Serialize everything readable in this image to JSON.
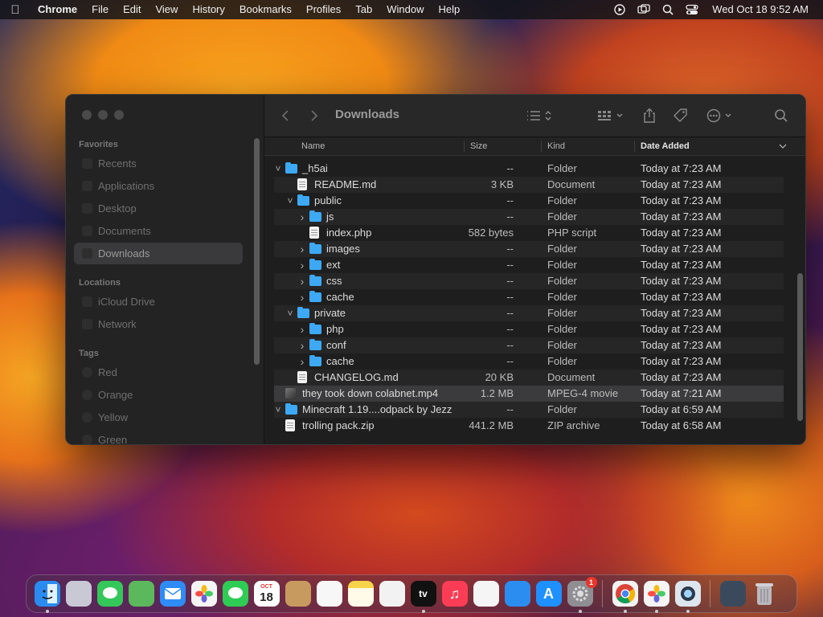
{
  "menubar": {
    "app": "Chrome",
    "items": [
      "File",
      "Edit",
      "View",
      "History",
      "Bookmarks",
      "Profiles",
      "Tab",
      "Window",
      "Help"
    ],
    "clock": "Wed Oct 18  9:52 AM"
  },
  "finder": {
    "title": "Downloads",
    "sidebar": {
      "favorites_label": "Favorites",
      "favorites": [
        "Recents",
        "Applications",
        "Desktop",
        "Documents",
        "Downloads"
      ],
      "locations_label": "Locations",
      "locations": [
        "iCloud Drive",
        "Network"
      ],
      "tags_label": "Tags",
      "tags": [
        "Red",
        "Orange",
        "Yellow",
        "Green"
      ]
    },
    "columns": {
      "name": "Name",
      "size": "Size",
      "kind": "Kind",
      "date": "Date Added"
    },
    "rows": [
      {
        "name": "_h5ai",
        "size": "--",
        "kind": "Folder",
        "date": "Today at 7:23 AM",
        "level": 0,
        "icon": "folder",
        "chevron": "down"
      },
      {
        "name": "README.md",
        "size": "3 KB",
        "kind": "Document",
        "date": "Today at 7:23 AM",
        "level": 1,
        "icon": "doc",
        "chevron": ""
      },
      {
        "name": "public",
        "size": "--",
        "kind": "Folder",
        "date": "Today at 7:23 AM",
        "level": 1,
        "icon": "folder",
        "chevron": "down"
      },
      {
        "name": "js",
        "size": "--",
        "kind": "Folder",
        "date": "Today at 7:23 AM",
        "level": 2,
        "icon": "folder",
        "chevron": "right"
      },
      {
        "name": "index.php",
        "size": "582 bytes",
        "kind": "PHP script",
        "date": "Today at 7:23 AM",
        "level": 2,
        "icon": "doc",
        "chevron": ""
      },
      {
        "name": "images",
        "size": "--",
        "kind": "Folder",
        "date": "Today at 7:23 AM",
        "level": 2,
        "icon": "folder",
        "chevron": "right"
      },
      {
        "name": "ext",
        "size": "--",
        "kind": "Folder",
        "date": "Today at 7:23 AM",
        "level": 2,
        "icon": "folder",
        "chevron": "right"
      },
      {
        "name": "css",
        "size": "--",
        "kind": "Folder",
        "date": "Today at 7:23 AM",
        "level": 2,
        "icon": "folder",
        "chevron": "right"
      },
      {
        "name": "cache",
        "size": "--",
        "kind": "Folder",
        "date": "Today at 7:23 AM",
        "level": 2,
        "icon": "folder",
        "chevron": "right"
      },
      {
        "name": "private",
        "size": "--",
        "kind": "Folder",
        "date": "Today at 7:23 AM",
        "level": 1,
        "icon": "folder",
        "chevron": "down"
      },
      {
        "name": "php",
        "size": "--",
        "kind": "Folder",
        "date": "Today at 7:23 AM",
        "level": 2,
        "icon": "folder",
        "chevron": "right"
      },
      {
        "name": "conf",
        "size": "--",
        "kind": "Folder",
        "date": "Today at 7:23 AM",
        "level": 2,
        "icon": "folder",
        "chevron": "right"
      },
      {
        "name": "cache",
        "size": "--",
        "kind": "Folder",
        "date": "Today at 7:23 AM",
        "level": 2,
        "icon": "folder",
        "chevron": "right"
      },
      {
        "name": "CHANGELOG.md",
        "size": "20 KB",
        "kind": "Document",
        "date": "Today at 7:23 AM",
        "level": 1,
        "icon": "doc",
        "chevron": ""
      },
      {
        "name": "they took down colabnet.mp4",
        "size": "1.2 MB",
        "kind": "MPEG-4 movie",
        "date": "Today at 7:21 AM",
        "level": 0,
        "icon": "movie",
        "chevron": "",
        "selected": true
      },
      {
        "name": "Minecraft 1.19....odpack by Jezz",
        "size": "--",
        "kind": "Folder",
        "date": "Today at 6:59 AM",
        "level": 0,
        "icon": "folder",
        "chevron": "down"
      },
      {
        "name": "trolling pack.zip",
        "size": "441.2 MB",
        "kind": "ZIP archive",
        "date": "Today at 6:58 AM",
        "level": 0,
        "icon": "doc",
        "chevron": ""
      }
    ]
  },
  "dock": {
    "calendar_month": "OCT",
    "calendar_day": "18",
    "settings_badge": "1",
    "tv_label": "tv",
    "icons": [
      {
        "name": "finder-icon",
        "color": "#2a8cf0",
        "running": true
      },
      {
        "name": "launchpad-icon",
        "color": "#c9c9d6",
        "running": false
      },
      {
        "name": "messages-icon",
        "color": "#34c759",
        "running": false
      },
      {
        "name": "maps-icon",
        "color": "#5cb85c",
        "running": false
      },
      {
        "name": "mail-icon",
        "color": "#2f8bf5",
        "running": false
      },
      {
        "name": "photos-icon",
        "color": "#f5f5f5",
        "running": false
      },
      {
        "name": "facetime-icon",
        "color": "#2ecc55",
        "running": false
      },
      {
        "name": "calendar-icon",
        "color": "#ffffff",
        "running": false
      },
      {
        "name": "contacts-icon",
        "color": "#c79a5f",
        "running": false
      },
      {
        "name": "reminders-icon",
        "color": "#f7f7f7",
        "running": false
      },
      {
        "name": "notes-icon",
        "color": "#f7d34a",
        "running": false
      },
      {
        "name": "freeform-icon",
        "color": "#f2f2f2",
        "running": false
      },
      {
        "name": "tv-icon",
        "color": "#111111",
        "running": true
      },
      {
        "name": "music-icon",
        "color": "#fa3d55",
        "running": false
      },
      {
        "name": "news-icon",
        "color": "#f5f5f5",
        "running": false
      },
      {
        "name": "keynote-icon",
        "color": "#2b8df0",
        "running": false
      },
      {
        "name": "app-store-icon",
        "color": "#1e90ff",
        "running": false
      },
      {
        "name": "system-settings-icon",
        "color": "#8e8e93",
        "running": true
      },
      {
        "name": "chrome-icon",
        "color": "#f2f2f2",
        "running": true
      },
      {
        "name": "photos-2-icon",
        "color": "#f5f5f5",
        "running": true
      },
      {
        "name": "quicktime-icon",
        "color": "#dde6ee",
        "running": true
      },
      {
        "name": "downloads-stack-icon",
        "color": "#3a4a5c",
        "running": false
      },
      {
        "name": "trash-icon",
        "color": "#8f8f95",
        "running": false
      }
    ]
  }
}
